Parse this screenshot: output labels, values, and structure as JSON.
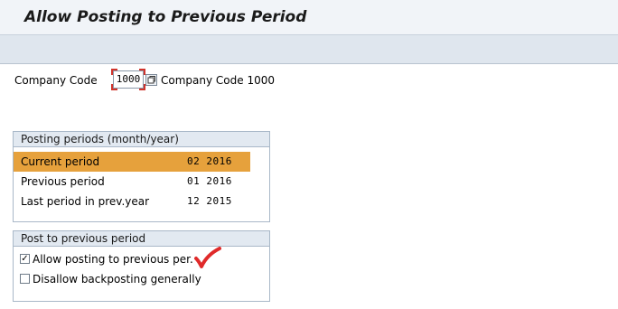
{
  "header": {
    "title": "Allow Posting to Previous Period"
  },
  "company": {
    "label": "Company Code",
    "code": "1000",
    "description": "Company Code 1000"
  },
  "posting_periods": {
    "title": "Posting periods (month/year)",
    "rows": [
      {
        "label": "Current period",
        "value": "02  2016",
        "selected": true
      },
      {
        "label": "Previous period",
        "value": "01  2016",
        "selected": false
      },
      {
        "label": "Last period in prev.year",
        "value": "12  2015",
        "selected": false
      }
    ]
  },
  "post_previous": {
    "title": "Post to previous period",
    "options": [
      {
        "label": "Allow posting to previous per.",
        "checked": true
      },
      {
        "label": "Disallow backposting generally",
        "checked": false
      }
    ]
  },
  "colors": {
    "selected_row": "#e6a13c",
    "annotation_check": "#e02a2a",
    "group_header": "#e2e9f1"
  }
}
